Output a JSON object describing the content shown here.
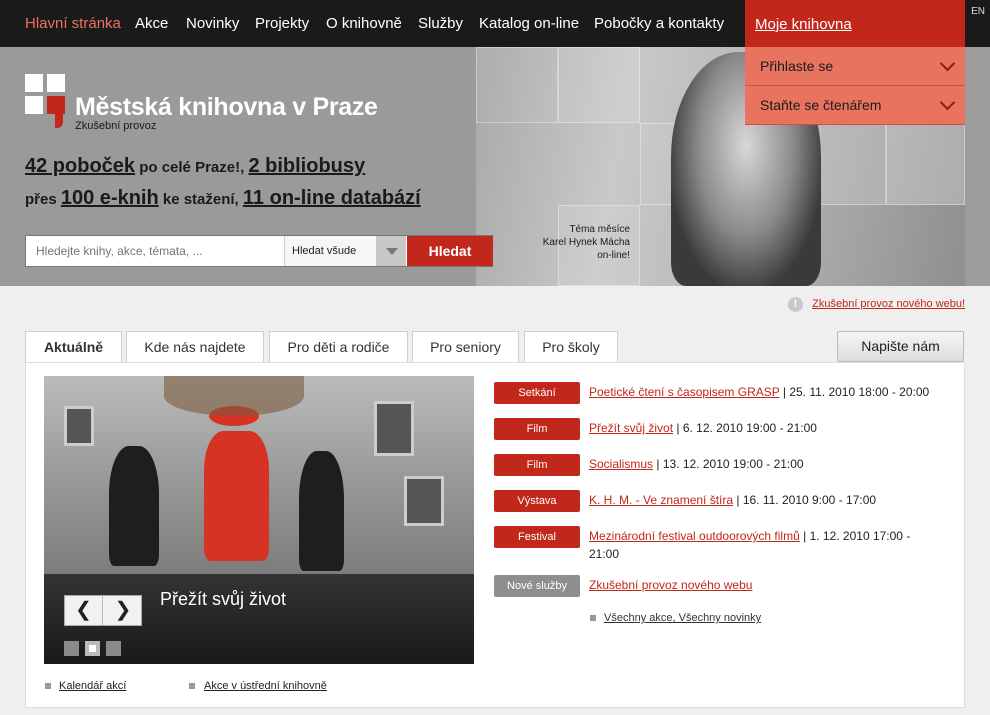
{
  "nav": {
    "items": [
      "Hlavní stránka",
      "Akce",
      "Novinky",
      "Projekty",
      "O knihovně",
      "Služby",
      "Katalog on-line",
      "Pobočky a kontakty"
    ],
    "lang": "EN"
  },
  "my_library": {
    "title": "Moje knihovna",
    "items": [
      "Přihlaste se",
      "Staňte se čtenářem"
    ]
  },
  "site": {
    "title": "Městská knihovna v Praze",
    "subtitle": "Zkušební provoz"
  },
  "stats": {
    "branches": "42 poboček",
    "branches_suffix": " po celé Praze!, ",
    "bibliobuses": "2 bibliobusy",
    "prefix2": "přes ",
    "ebooks": "100 e-knih",
    "ebooks_suffix": " ke stažení, ",
    "databases": "11 on-line databází"
  },
  "search": {
    "placeholder": "Hledejte knihy, akce, témata, ...",
    "scope": "Hledat všude",
    "button": "Hledat"
  },
  "theme": {
    "line1": "Téma měsíce",
    "line2": "Karel Hynek Mácha",
    "line3": "on-line!"
  },
  "notice": "Zkušební provoz nového webu!",
  "tabs": [
    "Aktuálně",
    "Kde nás najdete",
    "Pro děti a rodiče",
    "Pro seniory",
    "Pro školy"
  ],
  "write_us": "Napište nám",
  "slider": {
    "title": "Přežít svůj život",
    "prev": "❮",
    "next": "❯"
  },
  "bottom_links": [
    "Kalendář akcí",
    "Akce v ústřední knihovně"
  ],
  "events": [
    {
      "badge": "Setkání",
      "title": "Poetické čtení s časopisem GRASP",
      "info": " | 25. 11. 2010 18:00 - 20:00",
      "color": "#c1271a"
    },
    {
      "badge": "Film",
      "title": "Přežít svůj život",
      "info": " | 6. 12. 2010 19:00 - 21:00",
      "color": "#c1271a"
    },
    {
      "badge": "Film",
      "title": "Socialismus",
      "info": " | 13. 12. 2010 19:00 - 21:00",
      "color": "#c1271a"
    },
    {
      "badge": "Výstava",
      "title": "K. H. M. - Ve znamení štíra",
      "info": " | 16. 11. 2010 9:00 - 17:00",
      "color": "#c1271a"
    },
    {
      "badge": "Festival",
      "title": "Mezinárodní festival outdoorových filmů",
      "info": " | 1. 12. 2010 17:00 - 21:00",
      "color": "#c1271a"
    },
    {
      "badge": "Nové služby",
      "title": "Zkušební provoz nového webu",
      "info": "",
      "color": "#8e8e8e"
    }
  ],
  "all_links": {
    "actions": "Všechny akce",
    "sep": ", ",
    "news": "Všechny novinky"
  },
  "colors": {
    "brand_red": "#c1271a",
    "salmon": "#e8745f",
    "dark": "#1a1a1a"
  }
}
